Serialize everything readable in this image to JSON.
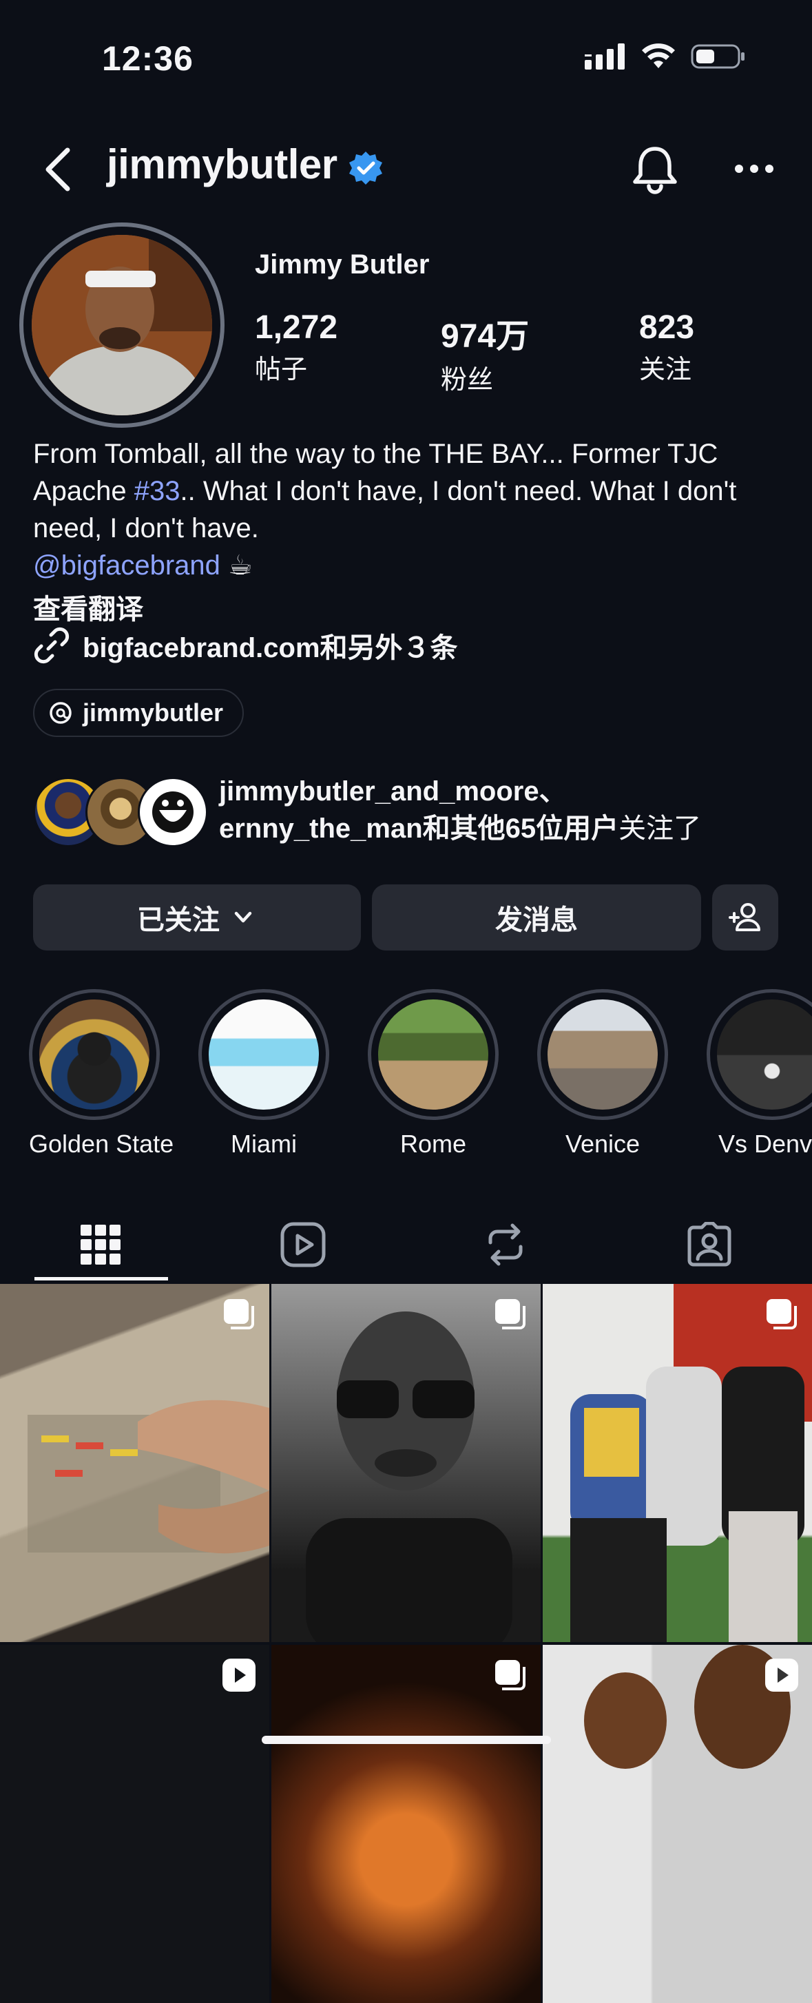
{
  "status_bar": {
    "time": "12:36"
  },
  "header": {
    "username": "jimmybutler"
  },
  "profile": {
    "full_name": "Jimmy Butler",
    "stats": [
      {
        "value": "1,272",
        "label": "帖子"
      },
      {
        "value": "974万",
        "label": "粉丝"
      },
      {
        "value": "823",
        "label": "关注"
      }
    ],
    "bio": {
      "line_part1": "From Tomball, all the way to the THE BAY... Former TJC Apache ",
      "hashtag": "#33",
      "line_part2": ".. What I don't have, I don't need. What I don't need, I don't have.",
      "mention": "@bigfacebrand",
      "emoji": "☕"
    },
    "translate_label": "查看翻译",
    "link_text": "bigfacebrand.com和另外３条",
    "threads_label": "jimmybutler",
    "mutual": {
      "line1": "jimmybutler_and_moore、",
      "line2_users": "ernny_the_man和其他65位用户",
      "line2_suffix": "关注了"
    }
  },
  "actions": {
    "following_label": "已关注",
    "message_label": "发消息"
  },
  "highlights": [
    {
      "label": "Golden State"
    },
    {
      "label": "Miami"
    },
    {
      "label": "Rome"
    },
    {
      "label": "Venice"
    },
    {
      "label": "Vs Denve"
    }
  ],
  "tabs": [
    "grid-icon",
    "reels-icon",
    "reposts-icon",
    "tagged-icon"
  ],
  "colors": {
    "background": "#0c0f17",
    "accent_link": "#8ea4ff",
    "verified": "#3897f0",
    "button": "#272a33"
  }
}
